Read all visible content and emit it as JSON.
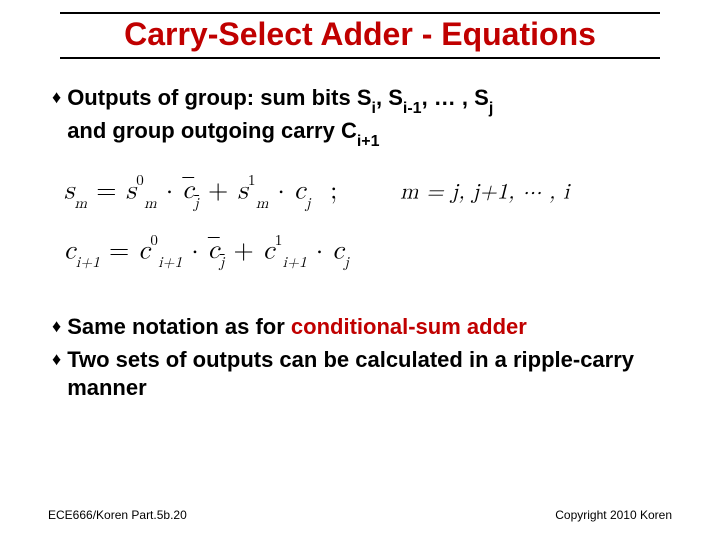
{
  "title": "Carry-Select Adder - Equations",
  "bullets": {
    "b1_pre": "Outputs of group: sum bits ",
    "b1_s_i": "S",
    "b1_s_i_sub": "i",
    "b1_sep1": ", ",
    "b1_s_im1": "S",
    "b1_s_im1_sub": "i-1",
    "b1_sep2": ", … , ",
    "b1_s_j": "S",
    "b1_s_j_sub": "j",
    "b1_line2a": "and group outgoing carry ",
    "b1_c": "C",
    "b1_c_sub": "i+1",
    "b2_pre": "Same notation as for ",
    "b2_red": "conditional-sum adder",
    "b3": "Two sets of outputs can be calculated in a ripple-carry manner"
  },
  "math1": {
    "lhs_s": "s",
    "lhs_sub": "m",
    "eq": " = ",
    "t1_s": "s",
    "t1_sup": "0",
    "t1_sub": "m",
    "dot": " · ",
    "t2_c": "c",
    "t2_sub": "j",
    "plus": " + ",
    "t3_s": "s",
    "t3_sup": "1",
    "t3_sub": "m",
    "t4_c": "c",
    "t4_sub": "j",
    "semi": " ; ",
    "range_pre": "m = j, j+1, ··· , i"
  },
  "math2": {
    "lhs_c": "c",
    "lhs_sub": "i+1",
    "eq": " = ",
    "t1_c": "c",
    "t1_sup": "0",
    "t1_sub": "i+1",
    "dot": " · ",
    "t2_c": "c",
    "t2_sub": "j",
    "plus": " + ",
    "t3_c": "c",
    "t3_sup": "1",
    "t3_sub": "i+1",
    "t4_c": "c",
    "t4_sub": "j"
  },
  "footer": {
    "left": "ECE666/Koren Part.5b.20",
    "right": "Copyright 2010 Koren"
  }
}
